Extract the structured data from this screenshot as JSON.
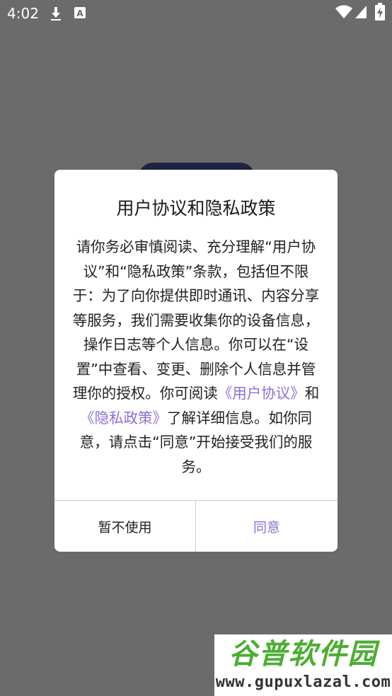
{
  "status_bar": {
    "time": "4:02",
    "icons": [
      "download-icon",
      "text-badge-icon",
      "wifi-icon",
      "signal-icon",
      "battery-charging-icon"
    ]
  },
  "dialog": {
    "title": "用户协议和隐私政策",
    "body_before_links": "请你务必审慎阅读、充分理解“用户协议”和“隐私政策”条款，包括但不限于：为了向你提供即时通讯、内容分享等服务，我们需要收集你的设备信息，操作日志等个人信息。你可以在“设置”中查看、变更、删除个人信息并管理你的授权。你可阅读",
    "link_user_agreement": "《用户协议》",
    "body_and": "和",
    "link_privacy_policy": "《隐私政策》",
    "body_after_links": "了解详细信息。如你同意，请点击“同意”开始接受我们的服务。",
    "cancel_label": "暂不使用",
    "agree_label": "同意"
  },
  "watermark": {
    "name": "谷普软件园",
    "url": "www.gupuxlazal.com"
  },
  "colors": {
    "overlay": "#6b6b6b",
    "accent": "#8d6fd6",
    "watermark_green": "#4cae32"
  }
}
